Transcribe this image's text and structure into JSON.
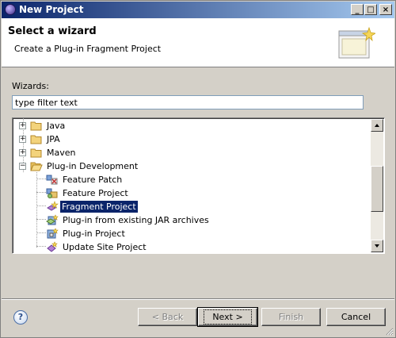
{
  "window": {
    "title": "New Project",
    "controls": {
      "minimize": "_",
      "maximize": "□",
      "close": "×"
    }
  },
  "header": {
    "title": "Select a wizard",
    "description": "Create a Plug-in Fragment Project",
    "banner_icon": "wizard-banner-icon"
  },
  "wizards_label": "Wizards:",
  "filter": {
    "value": "type filter text",
    "placeholder": "type filter text"
  },
  "tree": {
    "items": [
      {
        "label": "Java",
        "type": "folder",
        "expanded": false,
        "icon": "folder-icon"
      },
      {
        "label": "JPA",
        "type": "folder",
        "expanded": false,
        "icon": "folder-icon"
      },
      {
        "label": "Maven",
        "type": "folder",
        "expanded": false,
        "icon": "folder-icon"
      },
      {
        "label": "Plug-in Development",
        "type": "folder",
        "expanded": true,
        "icon": "folder-open-icon"
      },
      {
        "label": "Feature Patch",
        "type": "leaf",
        "icon": "feature-patch-icon"
      },
      {
        "label": "Feature Project",
        "type": "leaf",
        "icon": "feature-project-icon"
      },
      {
        "label": "Fragment Project",
        "type": "leaf",
        "icon": "fragment-project-icon",
        "selected": true
      },
      {
        "label": "Plug-in from existing JAR archives",
        "type": "leaf",
        "icon": "jar-plugin-icon"
      },
      {
        "label": "Plug-in Project",
        "type": "leaf",
        "icon": "plugin-project-icon"
      },
      {
        "label": "Update Site Project",
        "type": "leaf",
        "icon": "update-site-icon"
      }
    ]
  },
  "buttons": {
    "help": "?",
    "back": "< Back",
    "next": "Next >",
    "finish": "Finish",
    "cancel": "Cancel"
  },
  "colors": {
    "selection": "#0a246a",
    "dialog_bg": "#d4d0c8",
    "titlebar_start": "#0a246a",
    "titlebar_end": "#a6caf0"
  }
}
